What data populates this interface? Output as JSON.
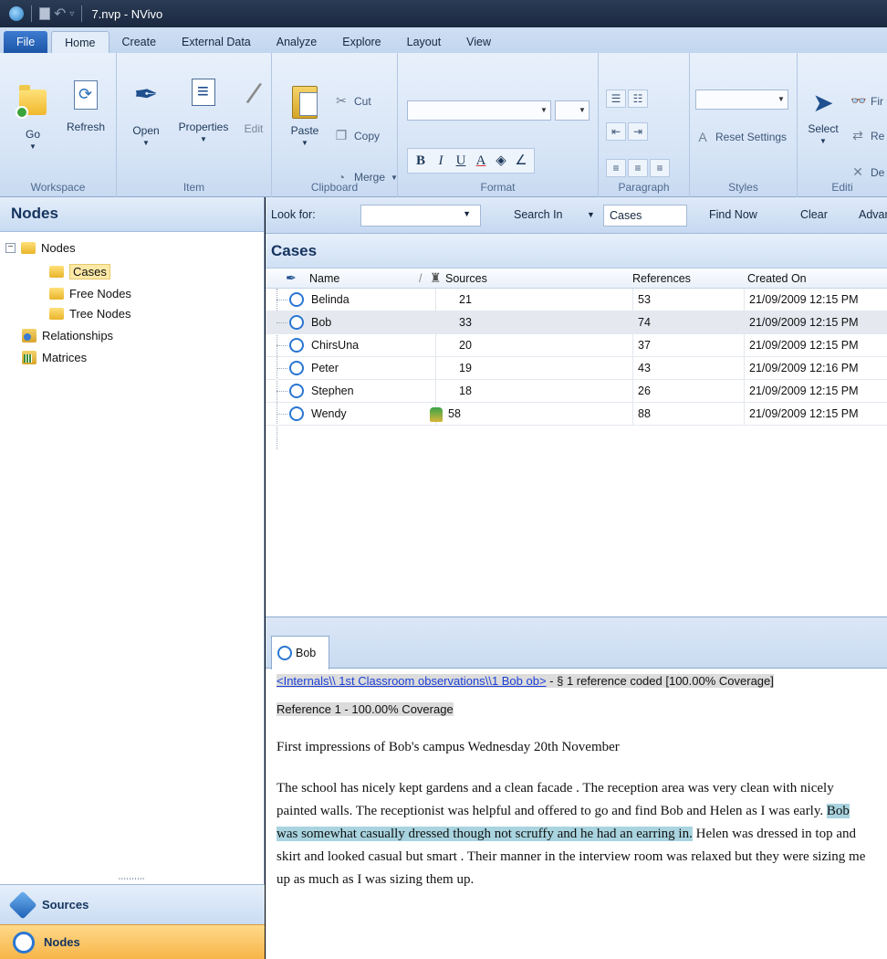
{
  "window": {
    "title": "7.nvp - NVivo"
  },
  "ribbon_tabs": [
    "File",
    "Home",
    "Create",
    "External Data",
    "Analyze",
    "Explore",
    "Layout",
    "View"
  ],
  "ribbon": {
    "workspace": {
      "go": "Go",
      "refresh": "Refresh",
      "label": "Workspace"
    },
    "item": {
      "open": "Open",
      "properties": "Properties",
      "edit": "Edit",
      "label": "Item"
    },
    "clipboard": {
      "paste": "Paste",
      "cut": "Cut",
      "copy": "Copy",
      "merge": "Merge",
      "label": "Clipboard"
    },
    "format": {
      "bold": "B",
      "italic": "I",
      "underline": "U",
      "font_color": "A",
      "label": "Format"
    },
    "paragraph": {
      "label": "Paragraph"
    },
    "styles": {
      "reset": "Reset Settings",
      "label": "Styles"
    },
    "editing": {
      "select": "Select",
      "find": "Fir",
      "replace": "Re",
      "delete": "De",
      "label": "Editi"
    }
  },
  "left_panel": {
    "title": "Nodes",
    "tree": {
      "root": "Nodes",
      "children": [
        "Cases",
        "Free Nodes",
        "Tree Nodes"
      ],
      "relationships": "Relationships",
      "matrices": "Matrices"
    },
    "nav": {
      "sources": "Sources",
      "nodes": "Nodes"
    }
  },
  "find_bar": {
    "look_for_label": "Look for:",
    "look_for_value": "",
    "search_in_label": "Search In",
    "search_in_value": "Cases",
    "find_now": "Find Now",
    "clear": "Clear",
    "advanced": "Advar"
  },
  "cases": {
    "title": "Cases",
    "columns": [
      "Name",
      "Sources",
      "References",
      "Created On"
    ],
    "rows": [
      {
        "name": "Belinda",
        "sources": "21",
        "references": "53",
        "created": "21/09/2009 12:15 PM"
      },
      {
        "name": "Bob",
        "sources": "33",
        "references": "74",
        "created": "21/09/2009 12:15 PM"
      },
      {
        "name": "ChirsUna",
        "sources": "20",
        "references": "37",
        "created": "21/09/2009 12:15 PM"
      },
      {
        "name": "Peter",
        "sources": "19",
        "references": "43",
        "created": "21/09/2009 12:16 PM"
      },
      {
        "name": "Stephen",
        "sources": "18",
        "references": "26",
        "created": "21/09/2009 12:15 PM"
      },
      {
        "name": "Wendy",
        "sources": "58",
        "references": "88",
        "created": "21/09/2009 12:15 PM"
      }
    ]
  },
  "detail": {
    "tab": "Bob",
    "link": "<Internals\\\\ 1st Classroom observations\\\\1 Bob ob>",
    "link_suffix": " - § 1 reference coded  [100.00% Coverage]",
    "reference": "Reference 1 - 100.00% Coverage",
    "heading": "First impressions of  Bob's campus Wednesday 20th November",
    "para_before": "The school has nicely kept gardens and a clean facade . The reception area was very clean with nicely painted walls. The  receptionist was helpful and offered to go and find Bob and Helen as I was early. ",
    "para_highlight": "Bob was somewhat casually dressed though not scruffy and he had an earring in.",
    "para_after": " Helen was dressed in  top and skirt and looked casual but smart . Their manner in the interview room was relaxed but they were sizing me up as much as I was sizing them up."
  }
}
